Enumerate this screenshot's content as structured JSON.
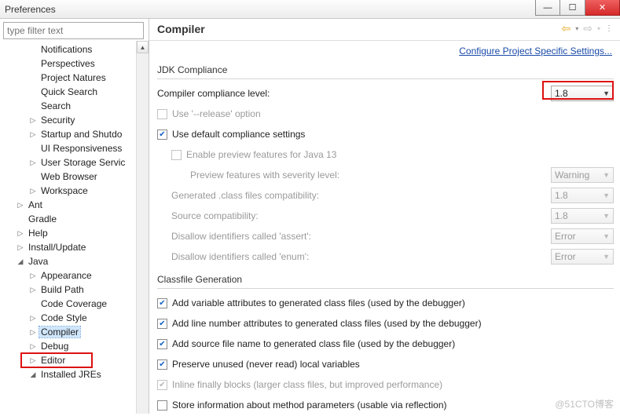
{
  "window": {
    "title": "Preferences"
  },
  "filter": {
    "placeholder": "type filter text"
  },
  "sidebar": {
    "items": [
      {
        "label": "Notifications",
        "depth": 2,
        "tw": ""
      },
      {
        "label": "Perspectives",
        "depth": 2,
        "tw": ""
      },
      {
        "label": "Project Natures",
        "depth": 2,
        "tw": ""
      },
      {
        "label": "Quick Search",
        "depth": 2,
        "tw": ""
      },
      {
        "label": "Search",
        "depth": 2,
        "tw": ""
      },
      {
        "label": "Security",
        "depth": 2,
        "tw": "▷"
      },
      {
        "label": "Startup and Shutdo",
        "depth": 2,
        "tw": "▷"
      },
      {
        "label": "UI Responsiveness",
        "depth": 2,
        "tw": ""
      },
      {
        "label": "User Storage Servic",
        "depth": 2,
        "tw": "▷"
      },
      {
        "label": "Web Browser",
        "depth": 2,
        "tw": ""
      },
      {
        "label": "Workspace",
        "depth": 2,
        "tw": "▷"
      },
      {
        "label": "Ant",
        "depth": 1,
        "tw": "▷"
      },
      {
        "label": "Gradle",
        "depth": 1,
        "tw": ""
      },
      {
        "label": "Help",
        "depth": 1,
        "tw": "▷"
      },
      {
        "label": "Install/Update",
        "depth": 1,
        "tw": "▷"
      },
      {
        "label": "Java",
        "depth": 1,
        "tw": "◢"
      },
      {
        "label": "Appearance",
        "depth": 2,
        "tw": "▷"
      },
      {
        "label": "Build Path",
        "depth": 2,
        "tw": "▷"
      },
      {
        "label": "Code Coverage",
        "depth": 2,
        "tw": ""
      },
      {
        "label": "Code Style",
        "depth": 2,
        "tw": "▷"
      },
      {
        "label": "Compiler",
        "depth": 2,
        "tw": "▷",
        "selected": true
      },
      {
        "label": "Debug",
        "depth": 2,
        "tw": "▷"
      },
      {
        "label": "Editor",
        "depth": 2,
        "tw": "▷"
      },
      {
        "label": "Installed JREs",
        "depth": 2,
        "tw": "◢"
      }
    ]
  },
  "content": {
    "title": "Compiler",
    "config_link": "Configure Project Specific Settings...",
    "jdk": {
      "legend": "JDK Compliance",
      "level_label": "Compiler compliance level:",
      "level_value": "1.8",
      "use_release": {
        "label": "Use '--release' option",
        "checked": false,
        "enabled": false
      },
      "use_default": {
        "label": "Use default compliance settings",
        "checked": true
      },
      "enable_preview": {
        "label": "Enable preview features for Java 13",
        "checked": false,
        "enabled": false
      },
      "preview_severity": {
        "label": "Preview features with severity level:",
        "value": "Warning"
      },
      "generated_compat": {
        "label": "Generated .class files compatibility:",
        "value": "1.8"
      },
      "source_compat": {
        "label": "Source compatibility:",
        "value": "1.8"
      },
      "assert_id": {
        "label": "Disallow identifiers called 'assert':",
        "value": "Error"
      },
      "enum_id": {
        "label": "Disallow identifiers called 'enum':",
        "value": "Error"
      }
    },
    "classfile": {
      "legend": "Classfile Generation",
      "c1": {
        "label": "Add variable attributes to generated class files (used by the debugger)",
        "checked": true
      },
      "c2": {
        "label": "Add line number attributes to generated class files (used by the debugger)",
        "checked": true
      },
      "c3": {
        "label": "Add source file name to generated class file (used by the debugger)",
        "checked": true
      },
      "c4": {
        "label": "Preserve unused (never read) local variables",
        "checked": true
      },
      "c5": {
        "label": "Inline finally blocks (larger class files, but improved performance)",
        "checked": true,
        "enabled": false
      },
      "c6": {
        "label": "Store information about method parameters (usable via reflection)",
        "checked": false
      }
    }
  },
  "watermark": "@51CTO博客"
}
